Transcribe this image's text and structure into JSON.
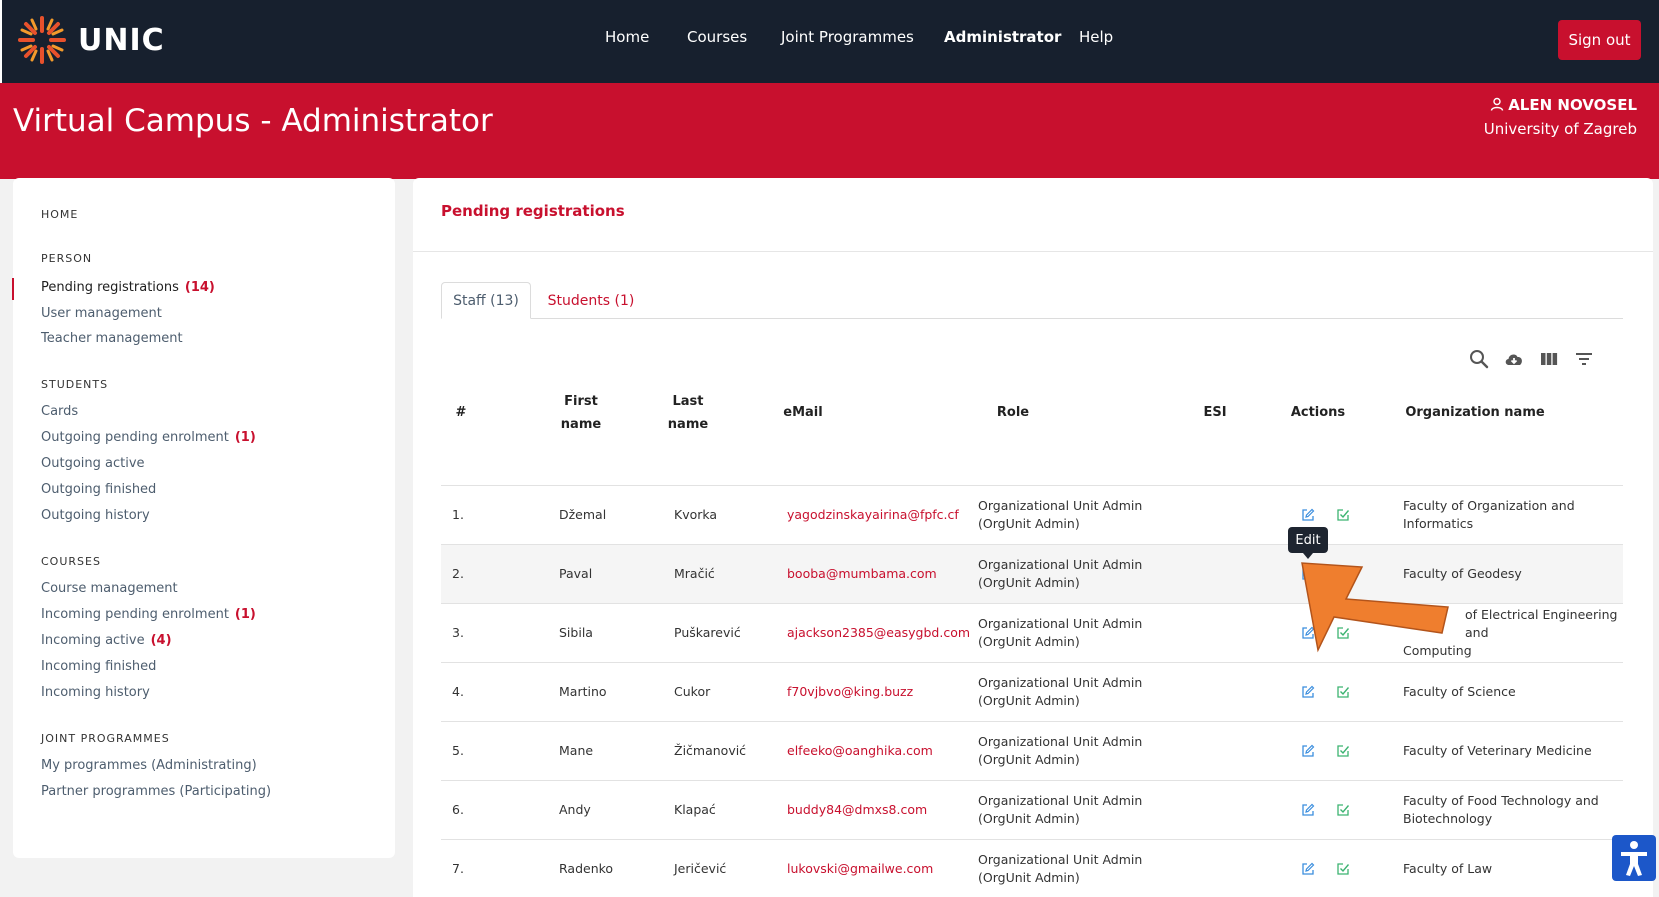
{
  "brand": {
    "name": "UNIC"
  },
  "nav": {
    "items": [
      {
        "label": "Home",
        "active": false
      },
      {
        "label": "Courses",
        "active": false
      },
      {
        "label": "Joint Programmes",
        "active": false
      },
      {
        "label": "Administrator",
        "active": true
      },
      {
        "label": "Help",
        "active": false
      }
    ],
    "signout_label": "Sign out"
  },
  "header": {
    "title": "Virtual Campus - Administrator",
    "user_name": "ALEN NOVOSEL",
    "user_org": "University of Zagreb"
  },
  "sidebar": {
    "home": "HOME",
    "person": {
      "heading": "PERSON",
      "items": [
        {
          "label": "Pending registrations",
          "count": "(14)"
        },
        {
          "label": "User management",
          "count": ""
        },
        {
          "label": "Teacher management",
          "count": ""
        }
      ]
    },
    "students": {
      "heading": "STUDENTS",
      "items": [
        {
          "label": "Cards",
          "count": ""
        },
        {
          "label": "Outgoing pending enrolment",
          "count": "(1)"
        },
        {
          "label": "Outgoing active",
          "count": ""
        },
        {
          "label": "Outgoing finished",
          "count": ""
        },
        {
          "label": "Outgoing history",
          "count": ""
        }
      ]
    },
    "courses": {
      "heading": "COURSES",
      "items": [
        {
          "label": "Course management",
          "count": ""
        },
        {
          "label": "Incoming pending enrolment",
          "count": "(1)"
        },
        {
          "label": "Incoming active",
          "count": "(4)"
        },
        {
          "label": "Incoming finished",
          "count": ""
        },
        {
          "label": "Incoming history",
          "count": ""
        }
      ]
    },
    "joint": {
      "heading": "JOINT PROGRAMMES",
      "items": [
        {
          "label": "My programmes (Administrating)",
          "count": ""
        },
        {
          "label": "Partner programmes (Participating)",
          "count": ""
        }
      ]
    }
  },
  "main": {
    "title": "Pending registrations",
    "tabs": [
      {
        "label": "Staff (13)"
      },
      {
        "label": "Students (1)"
      }
    ],
    "tooltip": "Edit"
  },
  "table": {
    "headers": {
      "num": "#",
      "first_1": "First",
      "first_2": "name",
      "last_1": "Last",
      "last_2": "name",
      "email": "eMail",
      "role": "Role",
      "esi": "ESI",
      "actions": "Actions",
      "org": "Organization name"
    },
    "rows": [
      {
        "num": "1.",
        "first": "Džemal",
        "last": "Kvorka",
        "email": "yagodzinskayairina@fpfc.cf",
        "role_1": "Organizational Unit Admin",
        "role_2": "(OrgUnit Admin)",
        "org_1": "Faculty of Organization and",
        "org_2": "Informatics"
      },
      {
        "num": "2.",
        "first": "Paval",
        "last": "Mračić",
        "email": "booba@mumbama.com",
        "role_1": "Organizational Unit Admin",
        "role_2": "(OrgUnit Admin)",
        "org_1": "Faculty of Geodesy",
        "org_2": ""
      },
      {
        "num": "3.",
        "first": "Sibila",
        "last": "Puškarević",
        "email": "ajackson2385@easygbd.com",
        "role_1": "Organizational Unit Admin",
        "role_2": "(OrgUnit Admin)",
        "org_1": "of Electrical Engineering and",
        "org_2": "Computing"
      },
      {
        "num": "4.",
        "first": "Martino",
        "last": "Cukor",
        "email": "f70vjbvo@king.buzz",
        "role_1": "Organizational Unit Admin",
        "role_2": "(OrgUnit Admin)",
        "org_1": "Faculty of Science",
        "org_2": ""
      },
      {
        "num": "5.",
        "first": "Mane",
        "last": "Žičmanović",
        "email": "elfeeko@oanghika.com",
        "role_1": "Organizational Unit Admin",
        "role_2": "(OrgUnit Admin)",
        "org_1": "Faculty of Veterinary Medicine",
        "org_2": ""
      },
      {
        "num": "6.",
        "first": "Andy",
        "last": "Klapać",
        "email": "buddy84@dmxs8.com",
        "role_1": "Organizational Unit Admin",
        "role_2": "(OrgUnit Admin)",
        "org_1": "Faculty of Food Technology and",
        "org_2": "Biotechnology"
      },
      {
        "num": "7.",
        "first": "Radenko",
        "last": "Jeričević",
        "email": "lukovski@gmailwe.com",
        "role_1": "Organizational Unit Admin",
        "role_2": "(OrgUnit Admin)",
        "org_1": "Faculty of Law",
        "org_2": ""
      }
    ]
  },
  "colors": {
    "brand_red": "#c8102e",
    "nav_dark": "#17202e",
    "edit_blue": "#3b8ede",
    "approve_green": "#3cb371",
    "arrow_orange": "#ef7e2e"
  }
}
